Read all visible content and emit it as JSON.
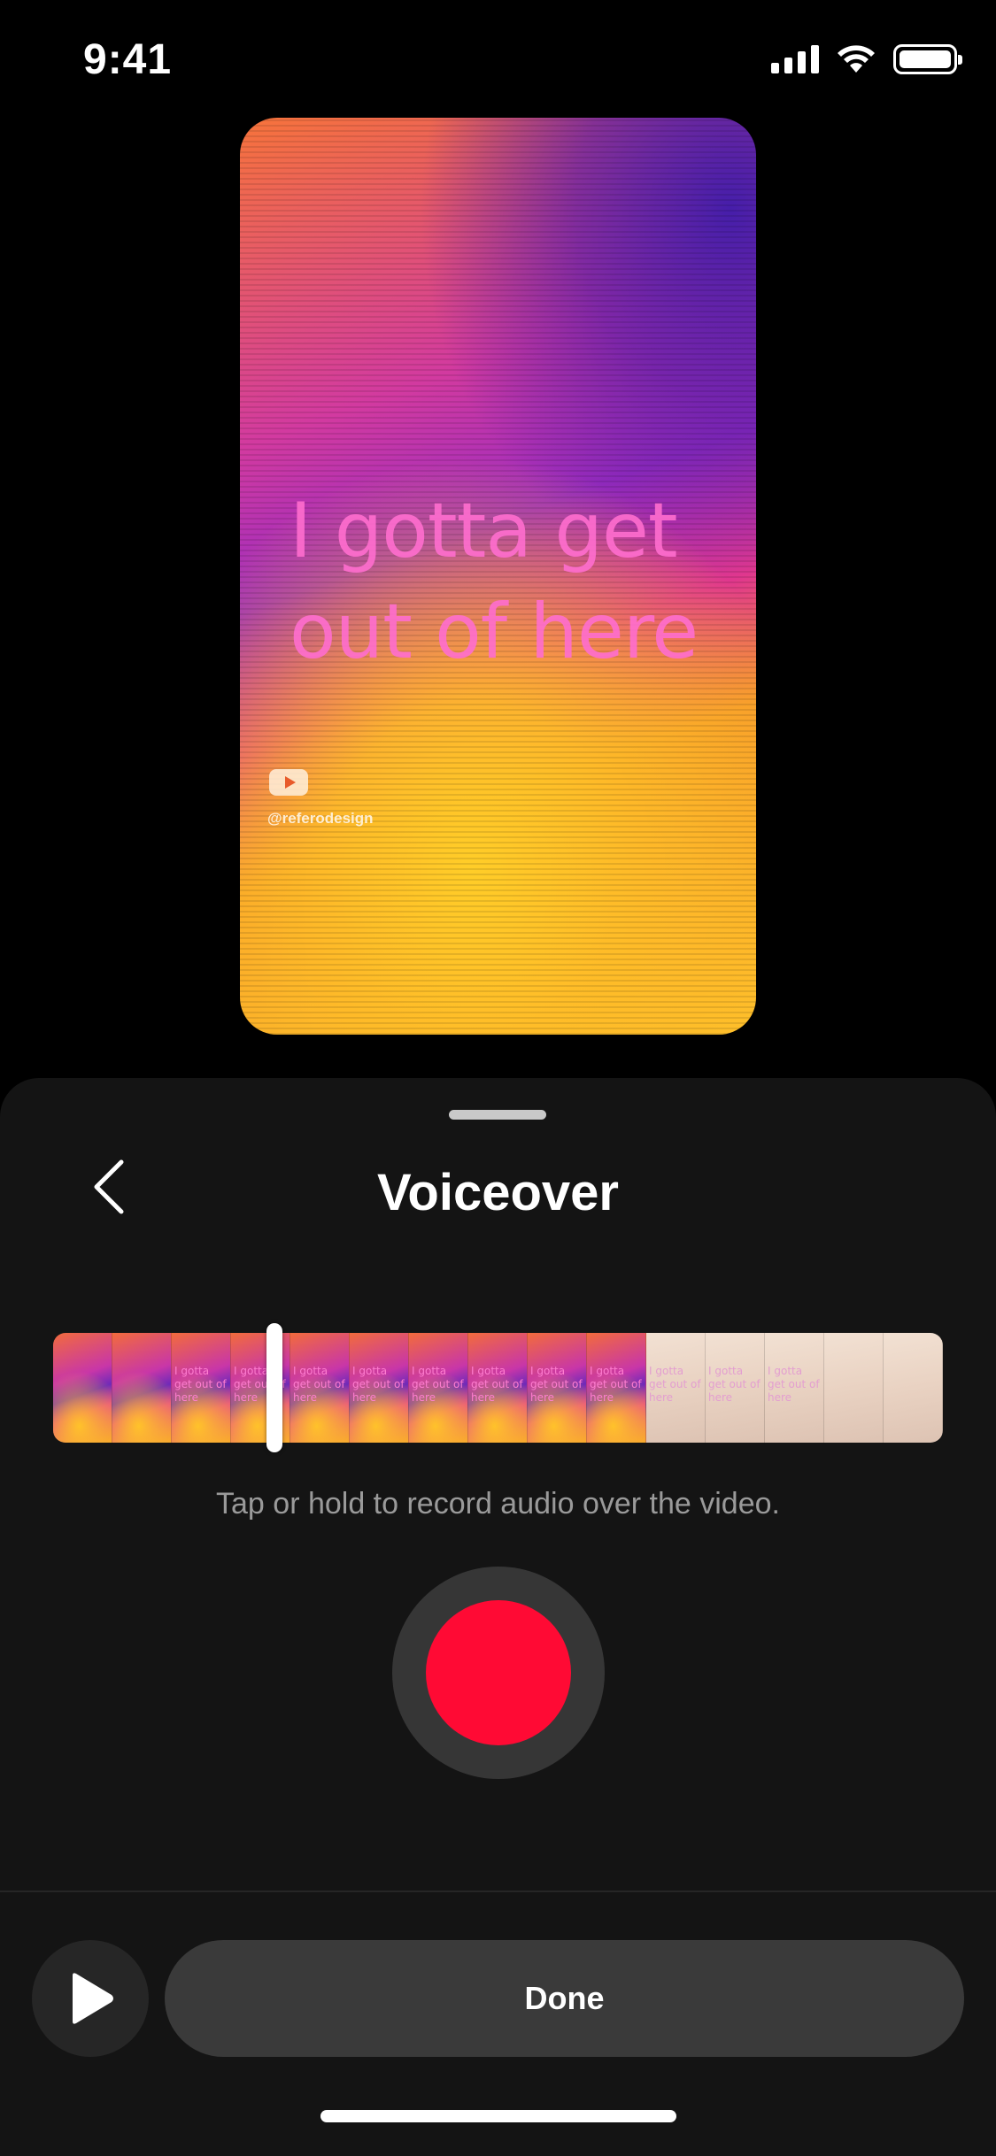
{
  "status_bar": {
    "time": "9:41"
  },
  "preview": {
    "caption": "I gotta get out of here",
    "handle": "@referodesign"
  },
  "sheet": {
    "title": "Voiceover",
    "hint": "Tap or hold to record audio over the video.",
    "timeline": {
      "frame_count": 15,
      "frame_text": "I gotta get out of here"
    },
    "done_label": "Done"
  },
  "colors": {
    "record": "#ff0a34",
    "sheet_background": "#141414",
    "done_button": "#3a3a3a"
  },
  "icons": [
    "signal-icon",
    "wifi-icon",
    "battery-icon",
    "back-chevron-icon",
    "play-icon",
    "youtube-icon",
    "record-icon"
  ]
}
